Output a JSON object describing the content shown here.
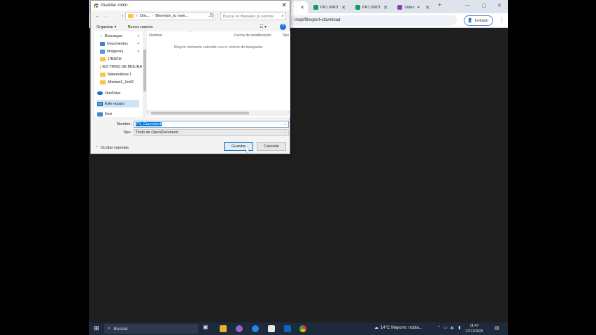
{
  "browser": {
    "tabs": [
      {
        "title": "PR1 WRIT",
        "color": "#0f9d58"
      },
      {
        "title": "PR1 WRIT",
        "color": "#0f9d58"
      },
      {
        "title": "Vídeo",
        "color": "#8e44ad"
      }
    ],
    "new_tab": "+",
    "url_fragment": "imqeff8export=download",
    "profile_label": "Invitado"
  },
  "dialog": {
    "title": "Guardar como",
    "close": "✕",
    "path": {
      "segments": [
        "Doc...",
        "Btorrejon_tu nom..."
      ]
    },
    "search_placeholder": "Buscar en Btorrejon_tu nombre",
    "organize": "Organizar ▾",
    "new_folder": "Nueva carpeta",
    "nav_items": [
      {
        "label": "Descargas",
        "icon": "download-icon"
      },
      {
        "label": "Documentos",
        "icon": "documents-icon"
      },
      {
        "label": "Imágenes",
        "icon": "images-icon"
      },
      {
        "label": "1ºBACH",
        "icon": "folder-icon"
      },
      {
        "label": "IES TIRSO DE MOLINA",
        "icon": "folder-icon"
      },
      {
        "label": "Matemáticas I",
        "icon": "folder-icon"
      },
      {
        "label": "Mindset1_Unit2",
        "icon": "folder-icon"
      },
      {
        "label": "OneDrive",
        "icon": "onedrive-icon"
      },
      {
        "label": "Este equipo",
        "icon": "computer-icon"
      },
      {
        "label": "Red",
        "icon": "network-icon"
      }
    ],
    "columns": {
      "name": "Nombre",
      "date": "Fecha de modificación",
      "type": "Tipo"
    },
    "empty_message": "Ningún elemento coincide con el criterio de búsqueda.",
    "filename_label": "Nombre:",
    "filename_value": "P1_Carproject",
    "type_label": "Tipo:",
    "type_value": "Texto de OpenDocument",
    "hide_folders": "Ocultar carpetas",
    "save_label": "Guardar",
    "cancel_label": "Cancelar"
  },
  "taskbar": {
    "search_label": "Buscar",
    "weather": "14°C  Mayorm. nubla...",
    "time": "11:47",
    "date": "17/11/2025"
  }
}
